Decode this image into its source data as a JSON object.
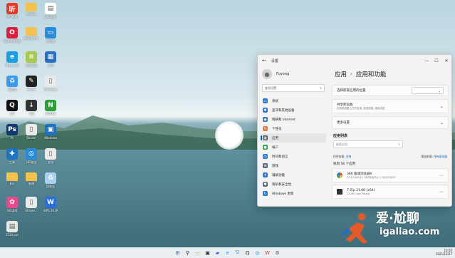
{
  "desktop": {
    "icons": [
      {
        "label": "PPT转换",
        "name": "ppt-icon",
        "color": "#e23b2e",
        "glyph": "昕"
      },
      {
        "label": "Adobe\nPremiere",
        "name": "folder-icon",
        "color": "#f2c14e",
        "glyph": ""
      },
      {
        "label": "360压缩",
        "name": "doc-icon",
        "color": "#ffffff",
        "glyph": "▤"
      },
      {
        "label": "Opera浏览器",
        "name": "opera-icon",
        "color": "#d9223f",
        "glyph": "O"
      },
      {
        "label": "新建文件夹",
        "name": "folder-icon",
        "color": "#f2c14e",
        "glyph": ""
      },
      {
        "label": "此电脑",
        "name": "monitor-icon",
        "color": "#2a8bd6",
        "glyph": "▭"
      },
      {
        "label": "Microsoft\nEdge",
        "name": "edge-icon",
        "color": "#1b9de2",
        "glyph": "e"
      },
      {
        "label": "百度网盘",
        "name": "notepad-icon",
        "color": "#a5c94a",
        "glyph": "≡"
      },
      {
        "label": "文档",
        "name": "doc-icon",
        "color": "#2a6fbf",
        "glyph": "▦"
      },
      {
        "label": "回收站",
        "name": "recycle-icon",
        "color": "#3d9be9",
        "glyph": "♻"
      },
      {
        "label": "Aomei",
        "name": "app-icon",
        "color": "#222222",
        "glyph": "✎"
      },
      {
        "label": "Windows\n文件",
        "name": "file-icon",
        "color": "#eaeaea",
        "glyph": "▯"
      },
      {
        "label": "QQ",
        "name": "qq-icon",
        "color": "#111111",
        "glyph": "Q"
      },
      {
        "label": "下载",
        "name": "app-icon",
        "color": "#333333",
        "glyph": "↓"
      },
      {
        "label": "NVIDIA",
        "name": "nvidia-icon",
        "color": "#2f9e38",
        "glyph": "N"
      },
      {
        "label": "Ps",
        "name": "ps-icon",
        "color": "#103a6e",
        "glyph": "Ps"
      },
      {
        "label": "Sticker",
        "name": "file-icon",
        "color": "#eaeaea",
        "glyph": "▯"
      },
      {
        "label": "Windows",
        "name": "app-icon",
        "color": "#1e73be",
        "glyph": "▣"
      },
      {
        "label": "工具",
        "name": "tool-icon",
        "color": "#1e73be",
        "glyph": "✚"
      },
      {
        "label": "360安全",
        "name": "app-icon",
        "color": "#2a8bd6",
        "glyph": "◎"
      },
      {
        "label": "文档",
        "name": "file-icon",
        "color": "#eaeaea",
        "glyph": "▯"
      },
      {
        "label": "Esc",
        "name": "folder-icon",
        "color": "#f2c14e",
        "glyph": ""
      },
      {
        "label": "新建",
        "name": "folder-icon",
        "color": "#f2c14e",
        "glyph": ""
      },
      {
        "label": "回收站",
        "name": "recycle-icon",
        "color": "#aad0ee",
        "glyph": "♻"
      },
      {
        "label": "360游戏\n大厅",
        "name": "game-icon",
        "color": "#e84a8c",
        "glyph": "✿"
      },
      {
        "label": "Sticker...",
        "name": "file-icon",
        "color": "#eaeaea",
        "glyph": "▯"
      },
      {
        "label": "WPS 2019",
        "name": "wps-icon",
        "color": "#2a6fd6",
        "glyph": "W"
      },
      {
        "label": "1234.ppt",
        "name": "pdf-icon",
        "color": "#e8e8e8",
        "glyph": "▤"
      }
    ]
  },
  "window": {
    "title": "设置",
    "controls": {
      "minimize": "—",
      "maximize": "☐",
      "close": "✕"
    },
    "user_name": "Fuyong",
    "search_placeholder": "查找设置",
    "nav": [
      {
        "label": "系统",
        "color": "#2a7ad6",
        "glyph": "▭"
      },
      {
        "label": "蓝牙和其他设备",
        "color": "#2a7ad6",
        "glyph": "✱"
      },
      {
        "label": "网络和 Internet",
        "color": "#3b78c2",
        "glyph": "◆"
      },
      {
        "label": "个性化",
        "color": "#e07a3a",
        "glyph": "✎"
      },
      {
        "label": "应用",
        "color": "#4a5a6a",
        "glyph": "▦",
        "active": true
      },
      {
        "label": "帐户",
        "color": "#2ca24c",
        "glyph": "●"
      },
      {
        "label": "时间和语言",
        "color": "#2a7ad6",
        "glyph": "◷"
      },
      {
        "label": "游戏",
        "color": "#5a6a7a",
        "glyph": "⊕"
      },
      {
        "label": "辅助功能",
        "color": "#2a7ad6",
        "glyph": "✦"
      },
      {
        "label": "隐私和安全性",
        "color": "#5a6a7a",
        "glyph": "⛊"
      },
      {
        "label": "Windows 更新",
        "color": "#2a7ad6",
        "glyph": "↻"
      }
    ],
    "breadcrumb": {
      "parent": "应用",
      "separator": "›",
      "current": "应用和功能"
    },
    "cards": [
      {
        "title": "选择获取应用的位置",
        "sub": "",
        "dropdown": "⌄"
      },
      {
        "title": "共享跨设备",
        "sub": "在其他设备上打开应用, 发送消息, 继续浏览",
        "right": "⌄"
      },
      {
        "title": "更多设置",
        "sub": "",
        "right": "⌄"
      }
    ],
    "app_list_title": "应用列表",
    "app_search_placeholder": "搜索应用",
    "filters": {
      "sort_label": "排序依据:",
      "sort_value": "名称",
      "filter_label": "筛选依据:",
      "filter_value": "所有驱动器"
    },
    "app_count": "找到 56 个应用",
    "apps": [
      {
        "name": "360 极速浏览器X",
        "meta": "21.0.1064.0  |  360安全中心  |  10/12/2021",
        "size": "",
        "icon_color": "#e84a3a"
      },
      {
        "name": "7-Zip 21.06 (x64)",
        "meta": "21.06  |  Igor Pavlov",
        "size": "",
        "icon_color": "#333333"
      }
    ]
  },
  "taskbar": {
    "icons": [
      {
        "name": "start-icon",
        "glyph": "⊞",
        "color": "#1e73be"
      },
      {
        "name": "search-icon",
        "glyph": "⚲",
        "color": "#222"
      },
      {
        "name": "file-explorer-icon",
        "glyph": "▭",
        "color": "#d9a23a"
      },
      {
        "name": "task-view-icon",
        "glyph": "▣",
        "color": "#333"
      },
      {
        "name": "chat-icon",
        "glyph": "▰",
        "color": "#5b5fc7"
      },
      {
        "name": "edge-icon",
        "glyph": "e",
        "color": "#1b9de2"
      },
      {
        "name": "store-icon",
        "glyph": "⛫",
        "color": "#2a7ad6"
      },
      {
        "name": "qq-icon",
        "glyph": "Q",
        "color": "#111"
      },
      {
        "name": "browser-icon",
        "glyph": "◎",
        "color": "#2a8bd6"
      },
      {
        "name": "wps-icon",
        "glyph": "W",
        "color": "#d93b3b"
      },
      {
        "name": "settings-icon",
        "glyph": "⚙",
        "color": "#555"
      }
    ],
    "time": "10:50",
    "date": "2021/12/27"
  },
  "watermark": {
    "line1": "爱·尬聊",
    "line2": "igaliao.com"
  }
}
